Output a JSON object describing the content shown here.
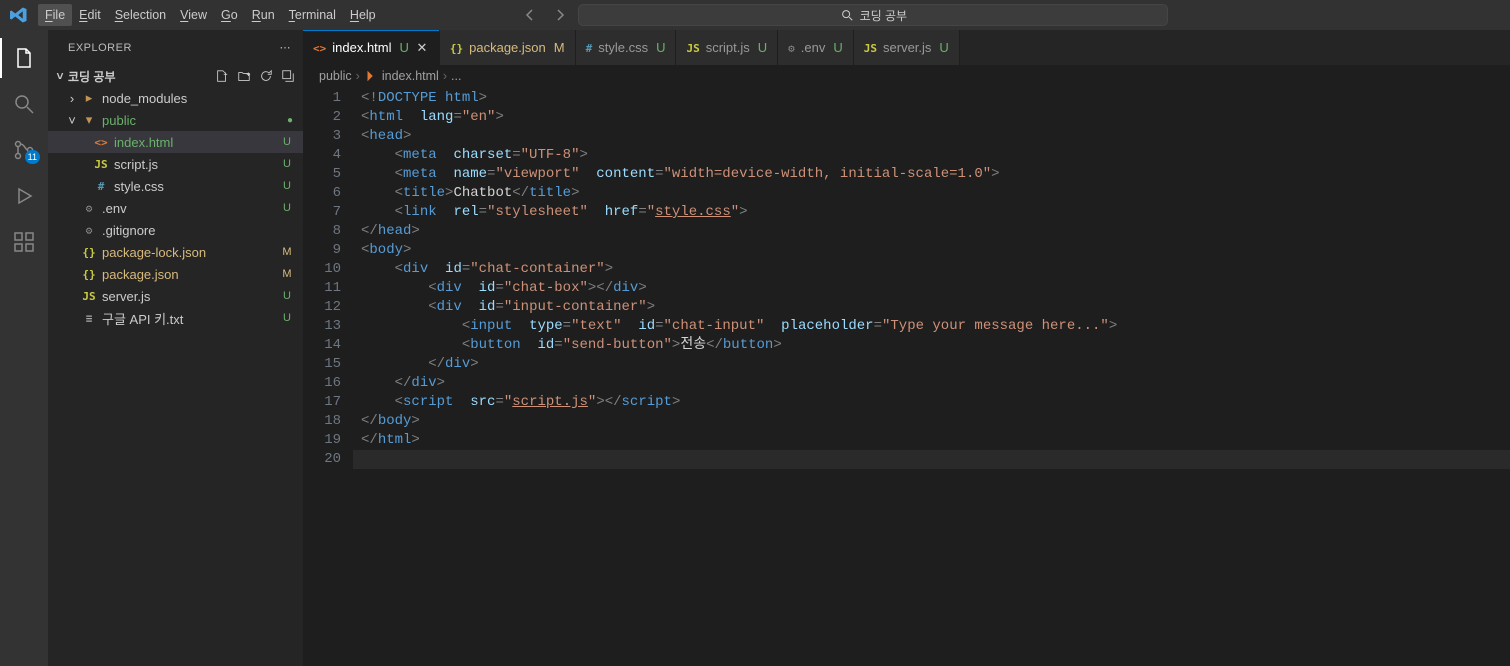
{
  "menubar": [
    "File",
    "Edit",
    "Selection",
    "View",
    "Go",
    "Run",
    "Terminal",
    "Help"
  ],
  "window_title": "코딩 공부",
  "activitybar": {
    "scm_badge": "11"
  },
  "sidebar": {
    "header": "EXPLORER",
    "workspace": "코딩 공부",
    "tree": [
      {
        "type": "folder",
        "name": "node_modules",
        "expanded": false,
        "depth": 1
      },
      {
        "type": "folder",
        "name": "public",
        "expanded": true,
        "depth": 1,
        "status": "dot",
        "green": true
      },
      {
        "type": "file",
        "name": "index.html",
        "icon": "html",
        "depth": 2,
        "status": "U",
        "selected": true,
        "green": true
      },
      {
        "type": "file",
        "name": "script.js",
        "icon": "js",
        "depth": 2,
        "status": "U"
      },
      {
        "type": "file",
        "name": "style.css",
        "icon": "css",
        "depth": 2,
        "status": "U"
      },
      {
        "type": "file",
        "name": ".env",
        "icon": "gear",
        "depth": 1,
        "status": "U"
      },
      {
        "type": "file",
        "name": ".gitignore",
        "icon": "gear",
        "depth": 1,
        "status": ""
      },
      {
        "type": "file",
        "name": "package-lock.json",
        "icon": "json",
        "depth": 1,
        "status": "M"
      },
      {
        "type": "file",
        "name": "package.json",
        "icon": "json",
        "depth": 1,
        "status": "M"
      },
      {
        "type": "file",
        "name": "server.js",
        "icon": "js",
        "depth": 1,
        "status": "U"
      },
      {
        "type": "file",
        "name": "구글 API 키.txt",
        "icon": "txt",
        "depth": 1,
        "status": "U"
      }
    ]
  },
  "tabs": [
    {
      "icon": "html",
      "label": "index.html",
      "status": "U",
      "active": true,
      "close": true
    },
    {
      "icon": "json",
      "label": "package.json",
      "status": "M",
      "close": false,
      "modified": true
    },
    {
      "icon": "css",
      "label": "style.css",
      "status": "U"
    },
    {
      "icon": "js",
      "label": "script.js",
      "status": "U"
    },
    {
      "icon": "gear",
      "label": ".env",
      "status": "U"
    },
    {
      "icon": "js",
      "label": "server.js",
      "status": "U"
    }
  ],
  "breadcrumb": [
    "public",
    "index.html",
    "..."
  ],
  "code_lines": [
    "<!DOCTYPE html>",
    "<html lang=\"en\">",
    "<head>",
    "    <meta charset=\"UTF-8\">",
    "    <meta name=\"viewport\" content=\"width=device-width, initial-scale=1.0\">",
    "    <title>Chatbot</title>",
    "    <link rel=\"stylesheet\" href=\"style.css\">",
    "</head>",
    "<body>",
    "    <div id=\"chat-container\">",
    "        <div id=\"chat-box\"></div>",
    "        <div id=\"input-container\">",
    "            <input type=\"text\" id=\"chat-input\" placeholder=\"Type your message here...\">",
    "            <button id=\"send-button\">전송</button>",
    "        </div>",
    "    </div>",
    "    <script src=\"script.js\"></script>",
    "</body>",
    "</html>",
    ""
  ]
}
